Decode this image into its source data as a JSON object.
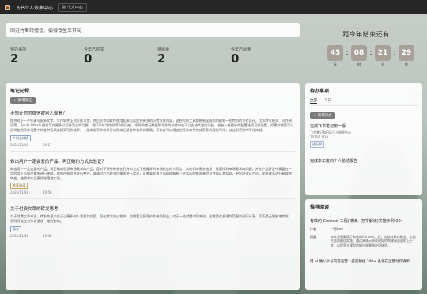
{
  "app": {
    "title": "飞书个人效率中心",
    "tab_label": "个人中心"
  },
  "quote": "固过竹篱疏借话，偷得浮生半日闲",
  "stats": [
    {
      "label": "待办事项",
      "value": "2"
    },
    {
      "label": "今年已完成",
      "value": "0"
    },
    {
      "label": "待阅读",
      "value": "2"
    },
    {
      "label": "今年已阅读",
      "value": "0"
    }
  ],
  "countdown": {
    "title": "距今年结束还有",
    "units": [
      {
        "value": "43",
        "label": "天"
      },
      {
        "value": "08",
        "label": "时"
      },
      {
        "value": "21",
        "label": "分"
      },
      {
        "value": "29",
        "label": "秒"
      }
    ]
  },
  "notes": {
    "title": "笔记記録",
    "add_label": "新增笔记",
    "search_label": "搜索",
    "items": [
      {
        "title": "不想让你的微信被别人偷看？",
        "body": "提供对于一个作者写很多文字、写作软件上的写作习惯，然后写作的软件使用起来可以提供更多的习惯写作内容，这些写作工具都拥有全面的功能和一些特别的写作设计，比如特写模式、写作预设等，Apple Watch 微信写作更多以写作为主的功能。我们平时写作时用到的功能，平时的笔记数据到写作的软件中也可以支持大量的功能，也有一些额外的配置选项可供设置，如果你需要可以选择使用写作设置中的各种选项来提高写作效率，一般来说写作软件可以用来记录各种各样的事情，写作者可以用这些写作软件完成更多内容的写作，以达到更好的写作体验。",
        "tag": "个别去体格",
        "tag_style": "blue",
        "date": "2025/11/18",
        "time": "20:17"
      },
      {
        "title": "做出用户一定会爱的产品，再正确的方式去验证？",
        "body": "做出用户一定会爱的产品，再正确地验证市场需求的产品，是对于那些希望在已有的方式下把握好的市场机会的人而言，从他们的需求出发，需要找到市场需求的问题，并在产品开发中需要在一定程度上与用户需求进行关联。即将所有信息进行整合，要通过产品将对应需求进行实现，这需要非常全面的理解和一些实际的需求来验证并保证其实现，更好地保证产品，能将理念进行有效地转变，使需求产品更好地落地实现。",
        "tag": "推荐阅读",
        "tag_style": "amber",
        "date": "2025/11/18",
        "time": "19:50"
      },
      {
        "title": "关于付费文章的转发思考",
        "body": "对于付费文章来说，转发的意义在于让更多的人看到其价值，但在转发的过程中，也需要注意保护作者的权益。对于一些付费内容来说，这需要在合理的范围内进行分享，而不是无限制地转发，否则可能会对作者造成一定的影响。",
        "tag": "思考",
        "tag_style": "blue",
        "date": "2025/11/18",
        "time": "19:48"
      }
    ]
  },
  "tasks": {
    "title": "待办事项",
    "tabs": [
      "全部",
      "今日"
    ],
    "add_label": "新增待办",
    "items": [
      {
        "name": "完成飞书笔记第一版",
        "sub": "飞书笔记和日历个人效率中心",
        "date": "2025/11/18",
        "status": "进行中"
      },
      {
        "name": "完成本年度的个人总结报告"
      }
    ]
  },
  "recommend": {
    "title": "推荐阅读",
    "article_title": "有效的 Context 工程(精读、万字解读)实施示例 004",
    "rows": [
      {
        "k": "作者",
        "v": "一直Ben"
      },
      {
        "k": "摘要",
        "v": "本文详细解读了有效的Context工程，包括其核心概念、实施方法和最佳实践。通过具体示例说明如何构建高质量的上下文，以提升大模型的输出效果和应用体验。"
      }
    ],
    "footer": "用 AI 做公众号内容运营：提前预估 100+ 条潜在运营动作清单"
  }
}
